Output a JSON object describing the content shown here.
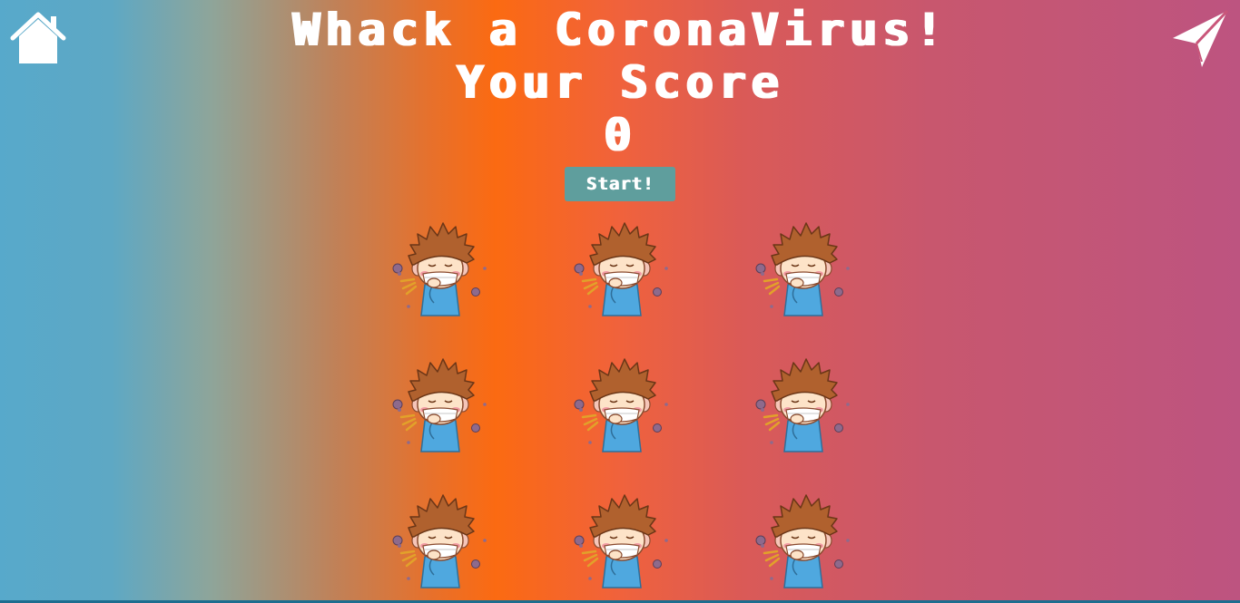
{
  "header": {
    "title": "Whack a CoronaVirus!",
    "score_label": "Your Score",
    "score_value": "0"
  },
  "controls": {
    "start_label": "Start!"
  },
  "nav": {
    "home_icon": "home-icon",
    "send_icon": "paper-plane-icon"
  },
  "board": {
    "rows": 3,
    "cols": 3,
    "character_icon": "sneezing-boy-with-mask-icon"
  },
  "colors": {
    "gradient_left": "#57a9cb",
    "gradient_center": "#fb6a12",
    "gradient_right": "#bd5480",
    "start_button": "#5f9e9d",
    "text": "#ffffff"
  }
}
